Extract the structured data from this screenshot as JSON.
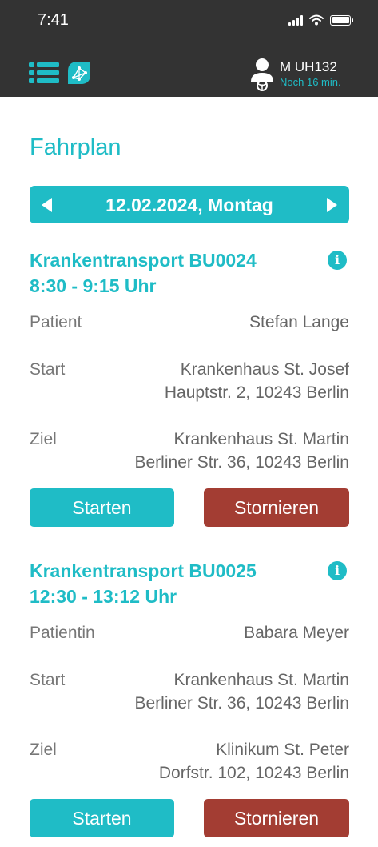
{
  "status": {
    "time": "7:41"
  },
  "header": {
    "user_name": "M UH132",
    "user_sub": "Noch 16 min."
  },
  "page": {
    "title": "Fahrplan",
    "date": "12.02.2024, Montag"
  },
  "transports": [
    {
      "title": "Krankentransport BU0024",
      "time": "8:30 - 9:15 Uhr",
      "patient_label": "Patient",
      "patient": "Stefan Lange",
      "start_label": "Start",
      "start_line1": "Krankenhaus St. Josef",
      "start_line2": "Hauptstr. 2, 10243 Berlin",
      "dest_label": "Ziel",
      "dest_line1": "Krankenhaus St. Martin",
      "dest_line2": "Berliner Str. 36, 10243 Berlin",
      "start_button": "Starten",
      "cancel_button": "Stornieren"
    },
    {
      "title": "Krankentransport BU0025",
      "time": "12:30 - 13:12 Uhr",
      "patient_label": "Patientin",
      "patient": "Babara Meyer",
      "start_label": "Start",
      "start_line1": "Krankenhaus St. Martin",
      "start_line2": "Berliner Str. 36, 10243 Berlin",
      "dest_label": "Ziel",
      "dest_line1": "Klinikum St. Peter",
      "dest_line2": "Dorfstr. 102, 10243 Berlin",
      "start_button": "Starten",
      "cancel_button": "Stornieren"
    }
  ],
  "colors": {
    "accent": "#1fbcc6",
    "cancel": "#a33d33",
    "header_bg": "#333333"
  },
  "icons": [
    "menu-icon",
    "network-leaf-icon",
    "user-icon",
    "info-icon",
    "chevron-left-icon",
    "chevron-right-icon",
    "wifi-icon",
    "battery-icon",
    "signal-icon"
  ]
}
